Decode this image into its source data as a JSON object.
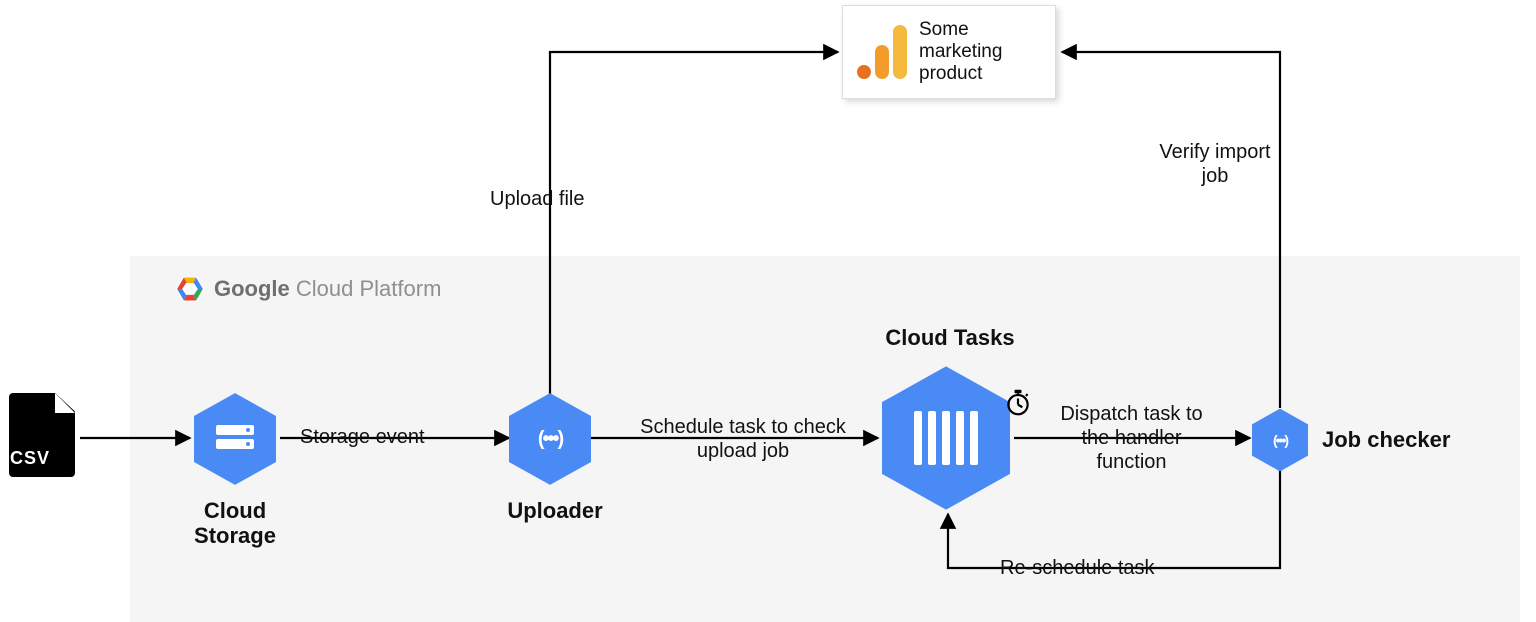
{
  "platform": {
    "brand": "Google",
    "name": "Cloud Platform"
  },
  "nodes": {
    "csv": {
      "label": "csv"
    },
    "cloud_storage": {
      "label": "Cloud Storage"
    },
    "uploader": {
      "label": "Uploader"
    },
    "cloud_tasks": {
      "label": "Cloud Tasks"
    },
    "job_checker": {
      "label": "Job checker"
    },
    "marketing_product": {
      "label": "Some marketing product"
    }
  },
  "edges": {
    "storage_event": "Storage event",
    "upload_file": "Upload file",
    "schedule_task": "Schedule task to check upload job",
    "dispatch_task": "Dispatch task to the handler function",
    "reschedule_task": "Re-schedule task",
    "verify_import": "Verify import job"
  }
}
